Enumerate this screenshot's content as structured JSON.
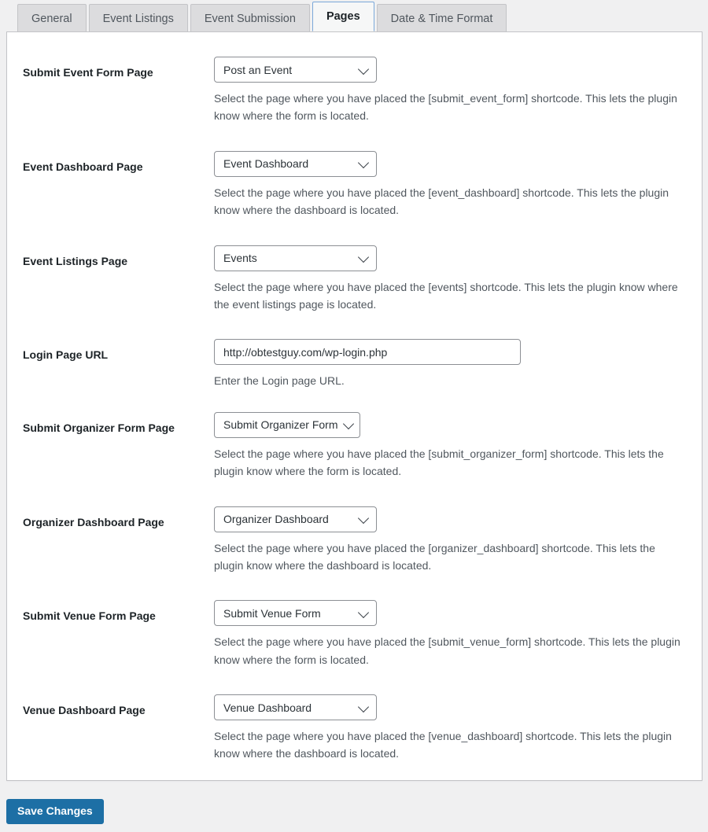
{
  "tabs": [
    {
      "label": "General",
      "active": false
    },
    {
      "label": "Event Listings",
      "active": false
    },
    {
      "label": "Event Submission",
      "active": false
    },
    {
      "label": "Pages",
      "active": true
    },
    {
      "label": "Date & Time Format",
      "active": false
    }
  ],
  "settings": {
    "rows": [
      {
        "label": "Submit Event Form Page",
        "control": "select",
        "value": "Post an Event",
        "description": "Select the page where you have placed the [submit_event_form] shortcode. This lets the plugin know where the form is located."
      },
      {
        "label": "Event Dashboard Page",
        "control": "select",
        "value": "Event Dashboard",
        "description": "Select the page where you have placed the [event_dashboard] shortcode. This lets the plugin know where the dashboard is located."
      },
      {
        "label": "Event Listings Page",
        "control": "select",
        "value": "Events",
        "description": "Select the page where you have placed the [events] shortcode. This lets the plugin know where the event listings page is located."
      },
      {
        "label": "Login Page URL",
        "control": "text",
        "value": "http://obtestguy.com/wp-login.php",
        "placeholder": "",
        "description": "Enter the Login page URL."
      },
      {
        "label": "Submit Organizer Form Page",
        "control": "select",
        "value": "Submit Organizer Form",
        "description": "Select the page where you have placed the [submit_organizer_form] shortcode. This lets the plugin know where the form is located."
      },
      {
        "label": "Organizer Dashboard Page",
        "control": "select",
        "value": "Organizer Dashboard",
        "description": "Select the page where you have placed the [organizer_dashboard] shortcode. This lets the plugin know where the dashboard is located."
      },
      {
        "label": "Submit Venue Form Page",
        "control": "select",
        "value": "Submit Venue Form",
        "description": "Select the page where you have placed the [submit_venue_form] shortcode. This lets the plugin know where the form is located."
      },
      {
        "label": "Venue Dashboard Page",
        "control": "select",
        "value": "Venue Dashboard",
        "description": "Select the page where you have placed the [venue_dashboard] shortcode. This lets the plugin know where the dashboard is located."
      }
    ]
  },
  "footer": {
    "save_label": "Save Changes"
  },
  "colors": {
    "accent": "#1d6fa5",
    "active_tab_border": "#7ba8d9",
    "page_background": "#f0f0f1",
    "panel_background": "#ffffff",
    "label_text": "#1d2327",
    "description_text": "#50575e",
    "control_border": "#8c8f94"
  }
}
